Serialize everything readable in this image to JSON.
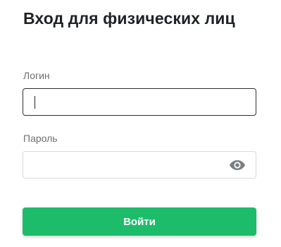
{
  "header": {
    "title": "Вход для физических лиц"
  },
  "form": {
    "login": {
      "label": "Логин",
      "value": "",
      "placeholder": ""
    },
    "password": {
      "label": "Пароль",
      "value": "",
      "placeholder": "",
      "toggle_icon": "eye-icon"
    },
    "submit_label": "Войти"
  },
  "colors": {
    "accent": "#1dbc6b",
    "text": "#1f2326",
    "label": "#6b6f73",
    "border_focused": "#2b2f33",
    "border": "#d6d9dc"
  }
}
